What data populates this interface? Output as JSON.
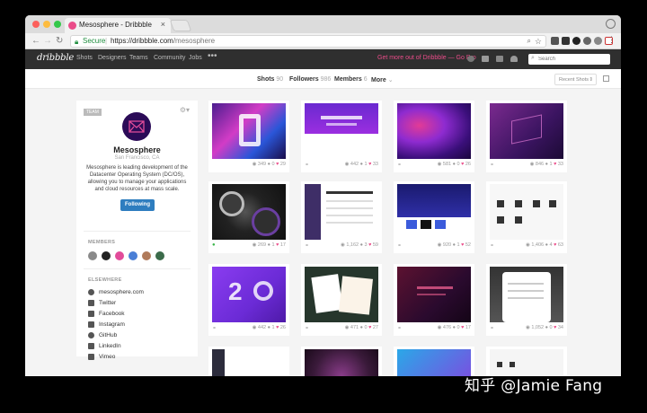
{
  "browser": {
    "tab_title": "Mesosphere - Dribbble",
    "tab_close": "×",
    "secure_label": "Secure",
    "url_host": "https://dribbble.com",
    "url_path": "/mesosphere"
  },
  "dribbble_nav": {
    "logo": "dribbble",
    "items": [
      "Shots",
      "Designers",
      "Teams",
      "Community",
      "Jobs"
    ],
    "more": "•••",
    "go_pro": "Get more out of Dribbble — Go Pro",
    "search_placeholder": "Search"
  },
  "subnav": {
    "shots_label": "Shots",
    "shots_count": "90",
    "followers_label": "Followers",
    "followers_count": "986",
    "members_label": "Members",
    "members_count": "6",
    "more_label": "More",
    "sort_label": "Recent Shots"
  },
  "profile": {
    "badge": "TEAM",
    "name": "Mesosphere",
    "location": "San Francisco, CA",
    "bio": "Mesosphere is leading development of the Datacenter Operating System (DC/OS), allowing you to manage your applications and cloud resources at mass scale.",
    "follow_label": "Following",
    "members_heading": "MEMBERS",
    "elsewhere_heading": "ELSEWHERE",
    "member_colors": [
      "#8a8a8a",
      "#222222",
      "#e24c9a",
      "#4a7fd6",
      "#b07a5a",
      "#3b6b4a"
    ],
    "links": [
      {
        "label": "mesosphere.com",
        "icon": "globe-icon"
      },
      {
        "label": "Twitter",
        "icon": "twitter-icon"
      },
      {
        "label": "Facebook",
        "icon": "facebook-icon"
      },
      {
        "label": "Instagram",
        "icon": "instagram-icon"
      },
      {
        "label": "GitHub",
        "icon": "github-icon"
      },
      {
        "label": "LinkedIn",
        "icon": "linkedin-icon"
      },
      {
        "label": "Vimeo",
        "icon": "vimeo-icon"
      }
    ]
  },
  "shots": [
    {
      "views": "349",
      "comments": "0",
      "likes": "29"
    },
    {
      "views": "442",
      "comments": "1",
      "likes": "33"
    },
    {
      "views": "581",
      "comments": "0",
      "likes": "26"
    },
    {
      "views": "846",
      "comments": "1",
      "likes": "33"
    },
    {
      "views": "269",
      "comments": "1",
      "likes": "17"
    },
    {
      "views": "1,162",
      "comments": "3",
      "likes": "59"
    },
    {
      "views": "920",
      "comments": "1",
      "likes": "52"
    },
    {
      "views": "1,406",
      "comments": "4",
      "likes": "63"
    },
    {
      "views": "442",
      "comments": "1",
      "likes": "26"
    },
    {
      "views": "471",
      "comments": "0",
      "likes": "27"
    },
    {
      "views": "476",
      "comments": "0",
      "likes": "17"
    },
    {
      "views": "1,052",
      "comments": "0",
      "likes": "34"
    }
  ],
  "watermark": "知乎 @Jamie Fang"
}
